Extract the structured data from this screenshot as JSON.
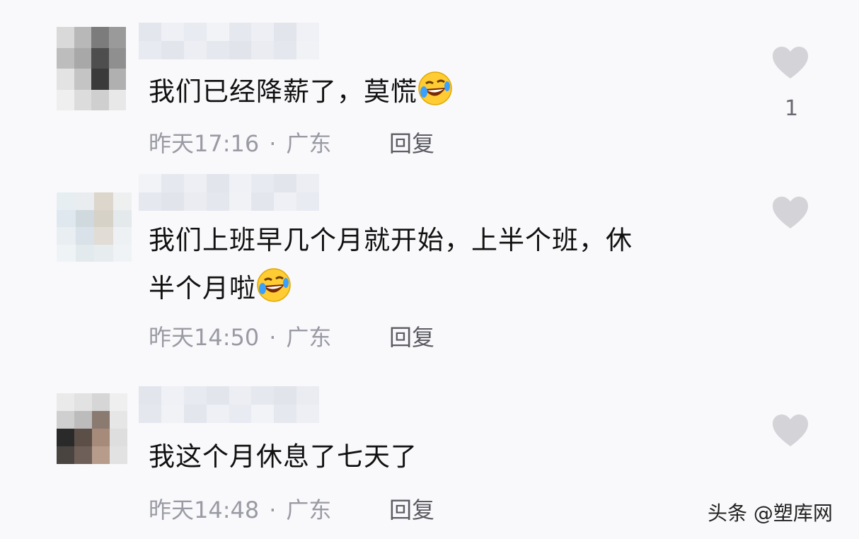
{
  "comments": [
    {
      "text": "我们已经降薪了，莫慌",
      "text_line2": "",
      "time": "昨天17:16",
      "location": "广东",
      "reply": "回复",
      "likes": "1",
      "emoji": "rolling-on-floor-laughing-icon",
      "avatar_colors": [
        "#d9d9d9",
        "#b8b8b8",
        "#7c7c7c",
        "#9a9a9a",
        "#bdbdbd",
        "#a8a8a8",
        "#4e4e4e",
        "#8f8f8f",
        "#e3e3e3",
        "#c4c4c4",
        "#3a3a3a",
        "#b0b0b0",
        "#efefef",
        "#dcdcdc",
        "#cfcfcf",
        "#e8e8e8"
      ]
    },
    {
      "text": "我们上班早几个月就开始，上半个班，休",
      "text_line2": "半个月啦",
      "time": "昨天14:50",
      "location": "广东",
      "reply": "回复",
      "likes": "",
      "emoji": "rolling-on-floor-laughing-icon",
      "avatar_colors": [
        "#e6eef2",
        "#e9edf0",
        "#dcd6cc",
        "#eef0f0",
        "#dfe8ee",
        "#cfd9de",
        "#d7d2c8",
        "#e4e9ec",
        "#e8eef1",
        "#d9e2e8",
        "#e1dcd5",
        "#edf1f3",
        "#eef3f5",
        "#e3eaee",
        "#e7ecef",
        "#f0f3f5"
      ]
    },
    {
      "text": "我这个月休息了七天了",
      "text_line2": "",
      "time": "昨天14:48",
      "location": "广东",
      "reply": "回复",
      "likes": "",
      "emoji": "",
      "avatar_colors": [
        "#eaeaea",
        "#e2e2e2",
        "#d6d6d6",
        "#efefef",
        "#cfcfcf",
        "#bcbcbc",
        "#8a7a70",
        "#e6e6e6",
        "#2a2a2a",
        "#5c4f48",
        "#a68a7a",
        "#dedede",
        "#4a4440",
        "#6e6058",
        "#b79c8c",
        "#e2e2e2"
      ]
    }
  ],
  "separator": "·",
  "watermark": "头条 @塑库网",
  "colors": {
    "text": "#111111",
    "meta": "#9a9aa4",
    "heart": "#d3d3d8"
  }
}
